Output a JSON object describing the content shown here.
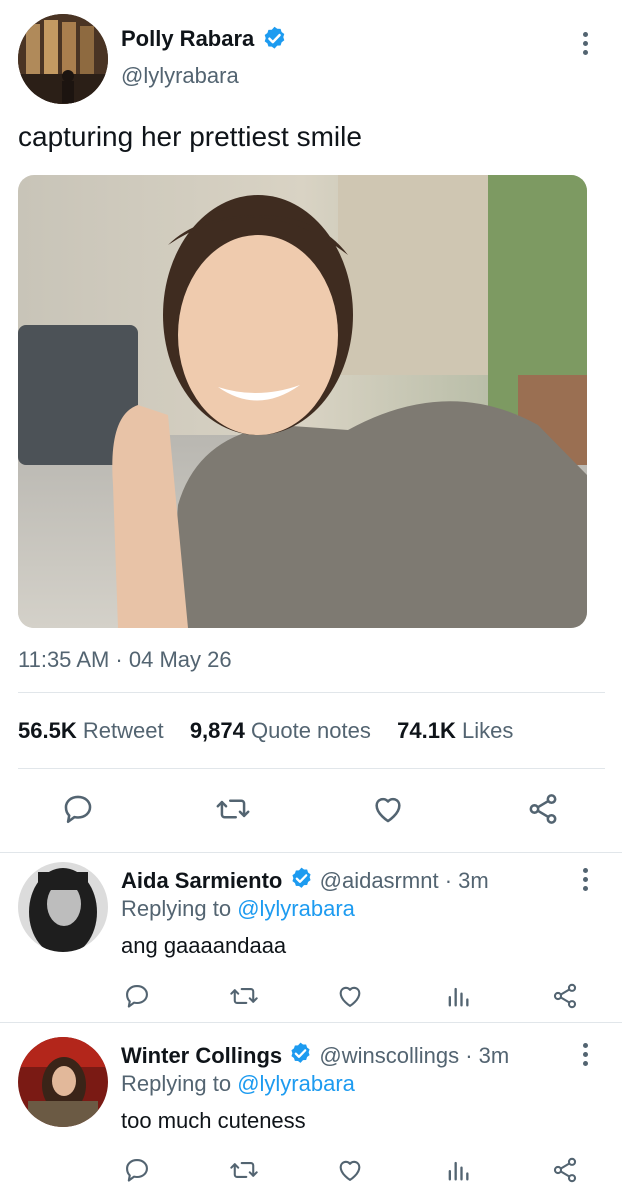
{
  "tweet": {
    "author_name": "Polly Rabara",
    "author_handle": "@lylyrabara",
    "text": "capturing her prettiest smile",
    "timestamp": "11:35 AM · 04 May 26",
    "stats": {
      "retweets_count": "56.5K",
      "retweets_label": "Retweet",
      "quotes_count": "9,874",
      "quotes_label": "Quote notes",
      "likes_count": "74.1K",
      "likes_label": "Likes"
    }
  },
  "replies": [
    {
      "author_name": "Aida Sarmiento",
      "author_handle": "@aidasrmnt",
      "time": "· 3m",
      "replying_prefix": "Replying to",
      "replying_handle": "@lylyrabara",
      "text": "ang gaaaandaaa"
    },
    {
      "author_name": "Winter Collings",
      "author_handle": "@winscollings",
      "time": "· 3m",
      "replying_prefix": "Replying to",
      "replying_handle": "@lylyrabara",
      "text": "too much cuteness"
    }
  ],
  "colors": {
    "accent": "#1d9bf0",
    "text": "#0f1419",
    "muted": "#536471",
    "divider": "#e1e6ea"
  },
  "icons": [
    "more-icon",
    "verified-icon",
    "reply-icon",
    "retweet-icon",
    "like-icon",
    "share-icon",
    "analytics-icon"
  ]
}
